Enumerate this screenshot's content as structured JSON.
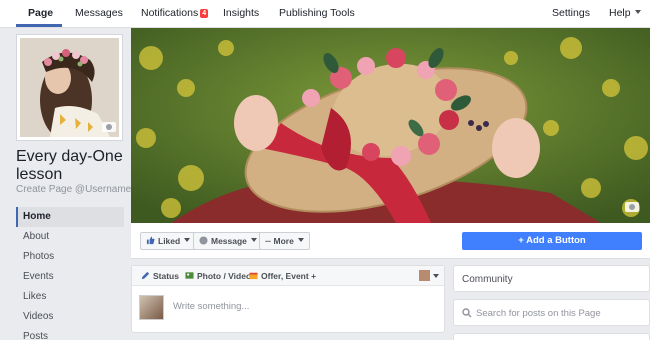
{
  "topnav": {
    "tabs": [
      {
        "label": "Page",
        "active": true
      },
      {
        "label": "Messages"
      },
      {
        "label": "Notifications",
        "badge": "4"
      },
      {
        "label": "Insights"
      },
      {
        "label": "Publishing Tools"
      }
    ],
    "right": [
      {
        "label": "Settings"
      },
      {
        "label": "Help"
      }
    ]
  },
  "page": {
    "name": "Every day-One lesson",
    "username_link": "Create Page @Username"
  },
  "leftnav": {
    "items": [
      {
        "label": "Home",
        "active": true
      },
      {
        "label": "About"
      },
      {
        "label": "Photos"
      },
      {
        "label": "Events"
      },
      {
        "label": "Likes"
      },
      {
        "label": "Videos"
      },
      {
        "label": "Posts"
      }
    ]
  },
  "actions": {
    "liked": "Liked",
    "message": "Message",
    "more": "More",
    "add_button": "+ Add a Button"
  },
  "composer": {
    "tabs": [
      {
        "label": "Status",
        "icon": "pencil-icon"
      },
      {
        "label": "Photo / Video",
        "icon": "photo-icon"
      },
      {
        "label": "Offer, Event +",
        "icon": "offer-icon"
      }
    ],
    "placeholder": "Write something..."
  },
  "sidebar": {
    "community_title": "Community",
    "search_placeholder": "Search for posts on this Page"
  },
  "colors": {
    "brand": "#4267b2",
    "add_button": "#4080ff",
    "notif_badge": "#fa3e3e"
  }
}
